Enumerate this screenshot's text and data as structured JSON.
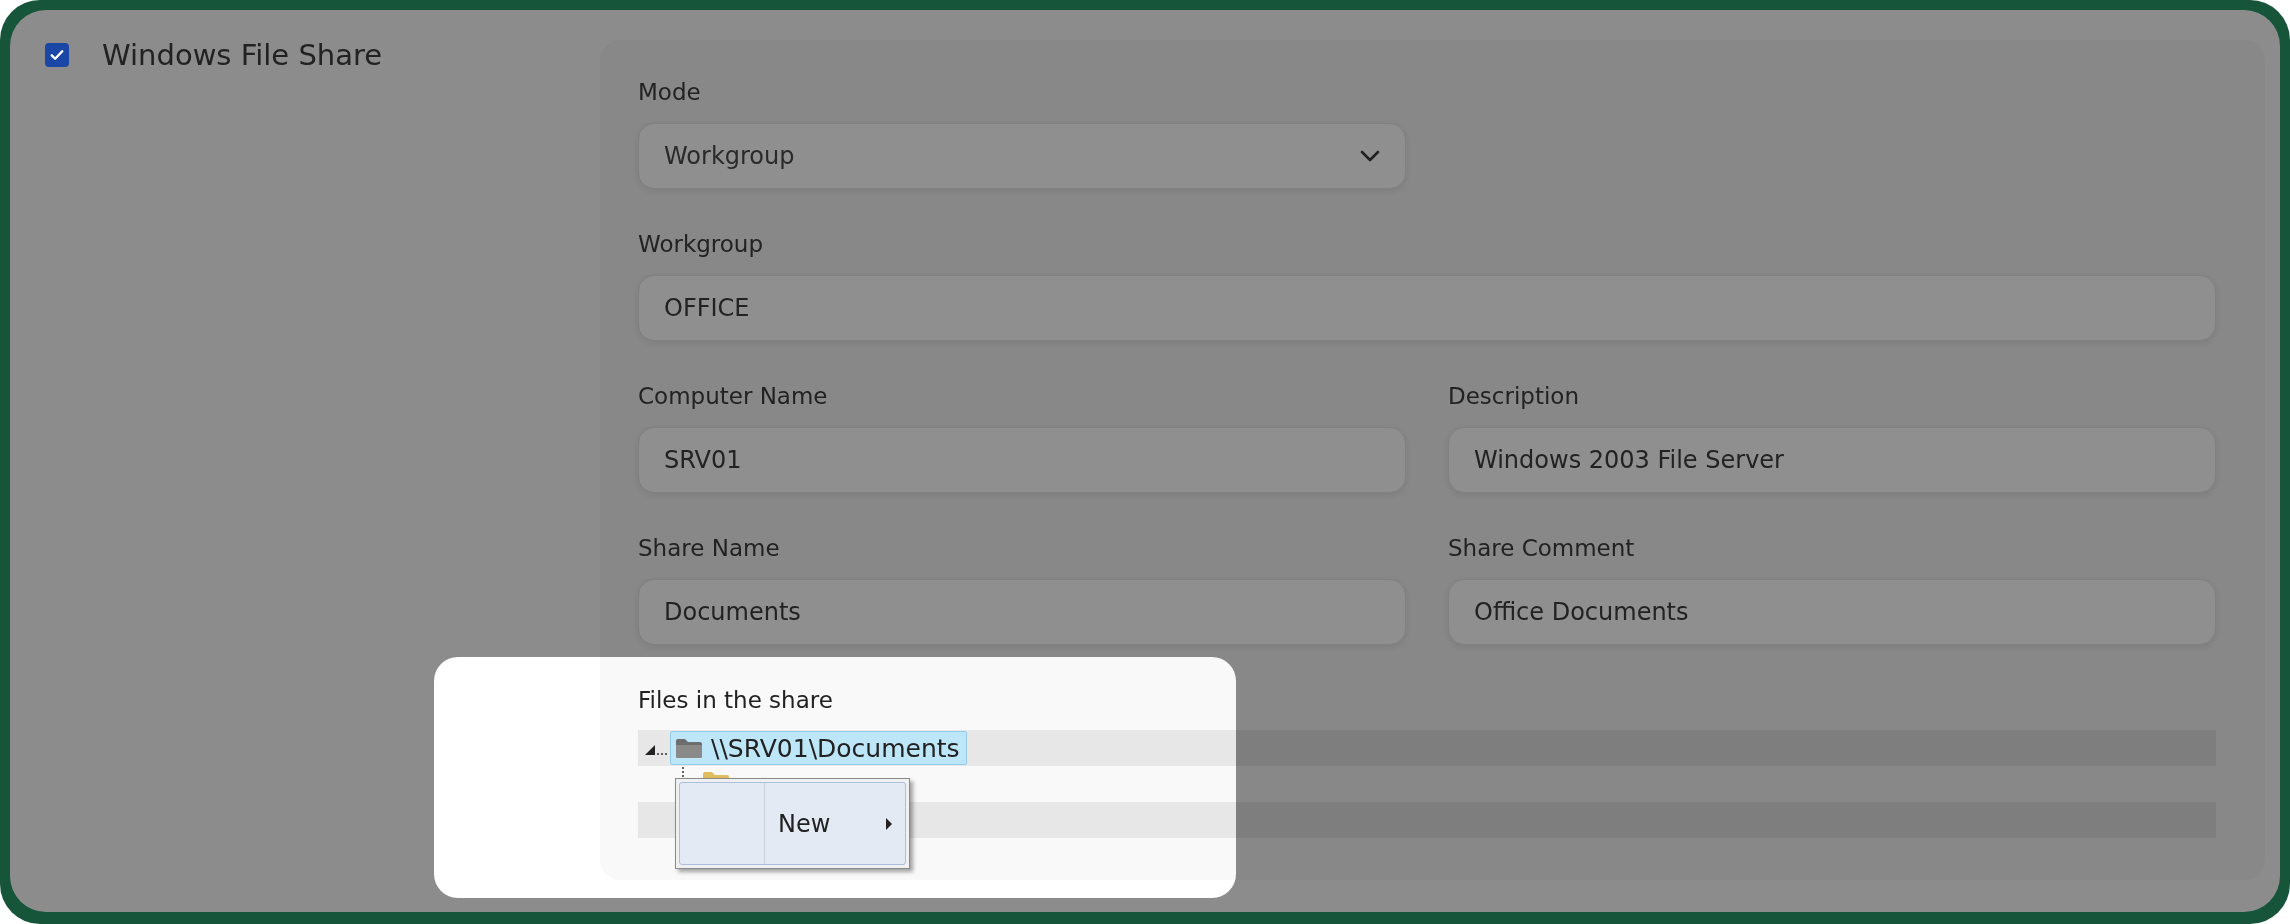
{
  "share": {
    "label": "Windows File Share",
    "checked": true
  },
  "mode": {
    "label": "Mode",
    "value": "Workgroup"
  },
  "workgroup": {
    "label": "Workgroup",
    "value": "OFFICE"
  },
  "fields": [
    {
      "label": "Computer Name",
      "value": "SRV01"
    },
    {
      "label": "Description",
      "value": "Windows 2003 File Server"
    },
    {
      "label": "Share Name",
      "value": "Documents"
    },
    {
      "label": "Share Comment",
      "value": "Office Documents"
    }
  ],
  "tree": {
    "label": "Files in the share",
    "items": [
      {
        "label": "\\\\SRV01\\Documents",
        "selected": true,
        "expanded": true,
        "children": [
          {
            "kind": "folder"
          }
        ]
      }
    ]
  },
  "context_menu": {
    "items": [
      {
        "label": "New",
        "submenu": true
      }
    ]
  }
}
